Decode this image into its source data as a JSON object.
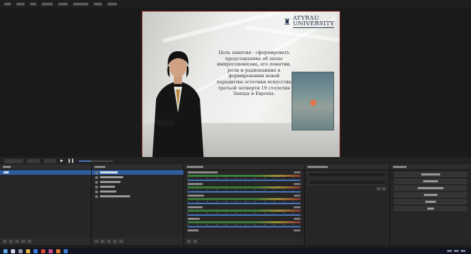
{
  "window": {
    "menu": [
      {
        "label": ""
      },
      {
        "label": ""
      },
      {
        "label": ""
      },
      {
        "label": ""
      },
      {
        "label": ""
      },
      {
        "label": ""
      },
      {
        "label": ""
      },
      {
        "label": ""
      }
    ]
  },
  "preview": {
    "logo_line1": "ATYRAU",
    "logo_line2": "UNIVERSITY",
    "slide_text": "Цель занятия - сформировать представление об эпохе импрессионизма, его понятии, роли и радиоканиие в формировании новой парадигмы эстетики искусства третьей четверти 19 столетия Запада и Европы.",
    "painting_caption_1": "",
    "painting_caption_2": ""
  },
  "toolbar": {
    "buttons": [
      {
        "label": ""
      },
      {
        "label": ""
      },
      {
        "label": ""
      }
    ],
    "stream_level": 0.35
  },
  "docks": {
    "scenes": {
      "title": "",
      "items": [
        {
          "label": "",
          "selected": true
        }
      ]
    },
    "sources": {
      "title": "",
      "items": [
        {
          "label": "",
          "selected": true
        },
        {
          "label": "",
          "selected": false
        },
        {
          "label": "",
          "selected": false
        },
        {
          "label": "",
          "selected": false
        },
        {
          "label": "",
          "selected": false
        },
        {
          "label": "",
          "selected": false
        }
      ]
    },
    "audio_mixer": {
      "title": "",
      "tracks": [
        {
          "label": "",
          "db": ""
        },
        {
          "label": "",
          "db": ""
        },
        {
          "label": "",
          "db": ""
        },
        {
          "label": "",
          "db": ""
        },
        {
          "label": "",
          "db": ""
        },
        {
          "label": "",
          "db": ""
        }
      ]
    },
    "transitions": {
      "title": "",
      "transition_type": "",
      "duration": ""
    },
    "controls": {
      "title": "",
      "buttons": [
        {
          "label": ""
        },
        {
          "label": ""
        },
        {
          "label": ""
        },
        {
          "label": ""
        },
        {
          "label": ""
        },
        {
          "label": ""
        }
      ]
    }
  },
  "colors": {
    "accent": "#2f5c9c",
    "preview_border": "#8c2b2b",
    "panel": "#262626"
  },
  "taskbar": {
    "icons": [
      "start-icon",
      "search-icon",
      "task-view-icon",
      "explorer-icon",
      "browser-icon",
      "app-icon",
      "app-icon",
      "app-icon",
      "app-icon"
    ],
    "clock": ""
  }
}
